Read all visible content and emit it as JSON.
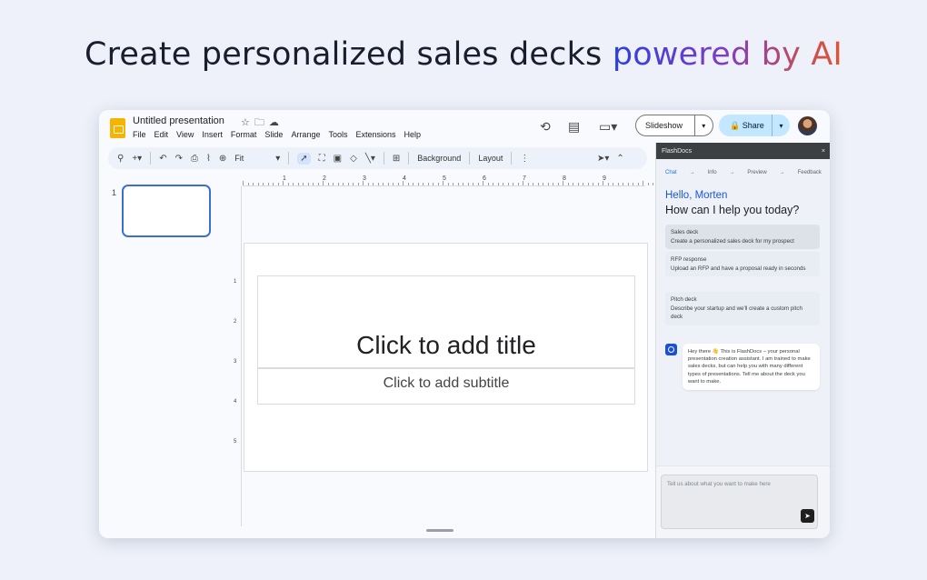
{
  "headline": {
    "part1": "Create personalized sales decks ",
    "part2": "powered by AI"
  },
  "app": {
    "title": "Untitled presentation",
    "menu": [
      "File",
      "Edit",
      "View",
      "Insert",
      "Format",
      "Slide",
      "Arrange",
      "Tools",
      "Extensions",
      "Help"
    ],
    "slideshow_label": "Slideshow",
    "share_label": "Share"
  },
  "toolbar": {
    "zoom": "Fit",
    "background_label": "Background",
    "layout_label": "Layout"
  },
  "ruler": {
    "top": [
      "1",
      "2",
      "3",
      "4",
      "5",
      "6",
      "7",
      "8",
      "9"
    ],
    "left": [
      "1",
      "2",
      "3",
      "4",
      "5"
    ]
  },
  "filmstrip": {
    "slide_number": "1"
  },
  "slide": {
    "title_placeholder": "Click to add title",
    "subtitle_placeholder": "Click to add subtitle"
  },
  "panel": {
    "name": "FlashDocs",
    "close": "×",
    "steps": [
      "Chat",
      "→",
      "Info",
      "→",
      "Preview",
      "→",
      "Feedback"
    ],
    "greeting": "Hello, Morten",
    "question": "How can I help you today?",
    "options": [
      {
        "title": "Sales deck",
        "desc": "Create a personalized sales deck for my prospect"
      },
      {
        "title": "RFP response",
        "desc": "Upload an RFP and have a proposal ready in seconds"
      },
      {
        "title": "Pitch deck",
        "desc": "Describe your startup and we'll create a custom pitch deck"
      }
    ],
    "bot_message": "Hey there 👋 This is FlashDocs – your personal presentation creation assistant. I am trained to make sales decks, but can help you with many different types of presentations. Tell me about the deck you want to make.",
    "input_placeholder": "Tell us about what you want to make here"
  }
}
